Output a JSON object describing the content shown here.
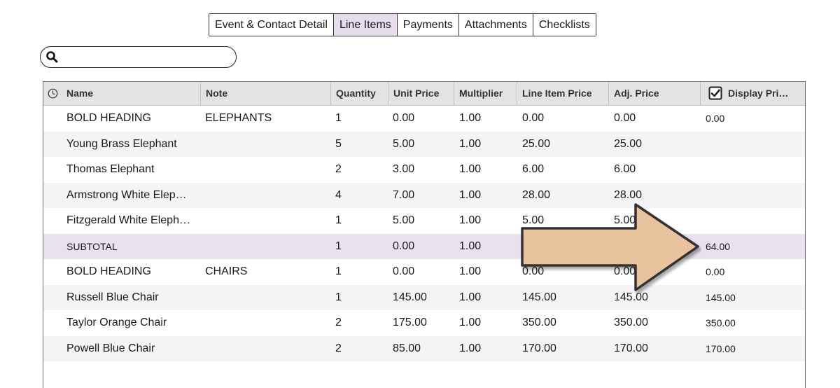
{
  "tabs": [
    {
      "label": "Event & Contact Detail",
      "active": false
    },
    {
      "label": "Line Items",
      "active": true
    },
    {
      "label": "Payments",
      "active": false
    },
    {
      "label": "Attachments",
      "active": false
    },
    {
      "label": "Checklists",
      "active": false
    }
  ],
  "search": {
    "value": "",
    "placeholder": ""
  },
  "columns": {
    "name": "Name",
    "note": "Note",
    "quantity": "Quantity",
    "unit_price": "Unit Price",
    "multiplier": "Multiplier",
    "line_item_price": "Line Item Price",
    "adj_price": "Adj. Price",
    "display_price": "Display Pri…",
    "display_price_checked": true
  },
  "rows": [
    {
      "name": "BOLD HEADING",
      "note": "ELEPHANTS",
      "quantity": "1",
      "unit_price": "0.00",
      "multiplier": "1.00",
      "line_item_price": "0.00",
      "adj_price": "0.00",
      "display_price": "0.00",
      "kind": "heading"
    },
    {
      "name": "Young Brass Elephant",
      "note": "",
      "quantity": "5",
      "unit_price": "5.00",
      "multiplier": "1.00",
      "line_item_price": "25.00",
      "adj_price": "25.00",
      "display_price": "",
      "kind": "item"
    },
    {
      "name": "Thomas Elephant",
      "note": "",
      "quantity": "2",
      "unit_price": "3.00",
      "multiplier": "1.00",
      "line_item_price": "6.00",
      "adj_price": "6.00",
      "display_price": "",
      "kind": "item"
    },
    {
      "name": "Armstrong White Elep…",
      "note": "",
      "quantity": "4",
      "unit_price": "7.00",
      "multiplier": "1.00",
      "line_item_price": "28.00",
      "adj_price": "28.00",
      "display_price": "",
      "kind": "item"
    },
    {
      "name": "Fitzgerald White Eleph…",
      "note": "",
      "quantity": "1",
      "unit_price": "5.00",
      "multiplier": "1.00",
      "line_item_price": "5.00",
      "adj_price": "5.00",
      "display_price": "",
      "kind": "item"
    },
    {
      "name": "SUBTOTAL",
      "note": "",
      "quantity": "1",
      "unit_price": "0.00",
      "multiplier": "1.00",
      "line_item_price": "",
      "adj_price": "",
      "display_price": "64.00",
      "kind": "subtotal"
    },
    {
      "name": "BOLD HEADING",
      "note": "CHAIRS",
      "quantity": "1",
      "unit_price": "0.00",
      "multiplier": "1.00",
      "line_item_price": "0.00",
      "adj_price": "0.00",
      "display_price": "0.00",
      "kind": "heading"
    },
    {
      "name": "Russell Blue Chair",
      "note": "",
      "quantity": "1",
      "unit_price": "145.00",
      "multiplier": "1.00",
      "line_item_price": "145.00",
      "adj_price": "145.00",
      "display_price": "145.00",
      "kind": "item"
    },
    {
      "name": "Taylor Orange Chair",
      "note": "",
      "quantity": "2",
      "unit_price": "175.00",
      "multiplier": "1.00",
      "line_item_price": "350.00",
      "adj_price": "350.00",
      "display_price": "350.00",
      "kind": "item"
    },
    {
      "name": "Powell Blue Chair",
      "note": "",
      "quantity": "2",
      "unit_price": "85.00",
      "multiplier": "1.00",
      "line_item_price": "170.00",
      "adj_price": "170.00",
      "display_price": "170.00",
      "kind": "item"
    }
  ],
  "colors": {
    "active_tab": "#e6dcec",
    "subtotal_row": "#e9e1ef",
    "header_bg": "#e3e3e3",
    "alt_row": "#f4f4f4",
    "arrow_fill": "#e8c39e",
    "arrow_stroke": "#333333"
  },
  "icons": {
    "search": "search-icon",
    "history": "clock-icon",
    "display_toggle": "checkbox-checked-icon",
    "callout": "arrow-right-icon"
  }
}
